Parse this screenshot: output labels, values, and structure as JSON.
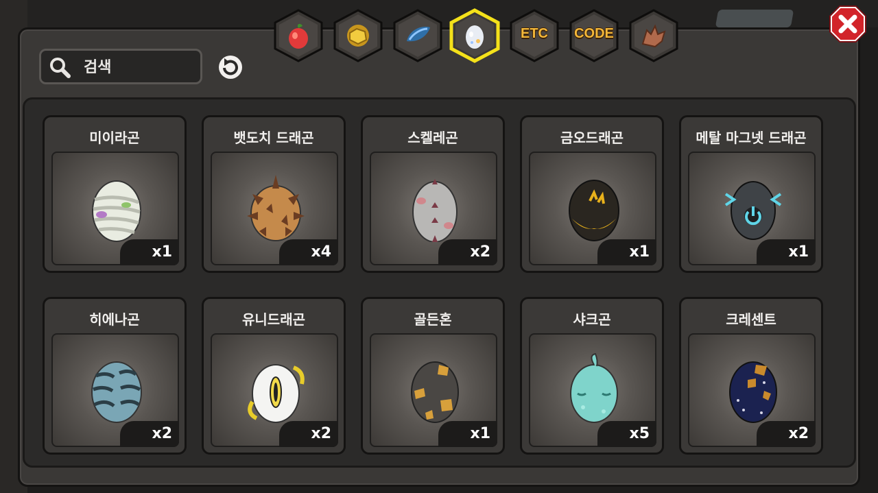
{
  "search": {
    "placeholder": "검색"
  },
  "tabs": [
    {
      "icon": "fruit-icon",
      "label": ""
    },
    {
      "icon": "gold-ore-icon",
      "label": ""
    },
    {
      "icon": "fish-icon",
      "label": ""
    },
    {
      "icon": "egg-icon",
      "label": "",
      "active": true
    },
    {
      "icon": "etc-icon",
      "label": "ETC"
    },
    {
      "icon": "code-icon",
      "label": "CODE"
    },
    {
      "icon": "dragon-head-icon",
      "label": ""
    }
  ],
  "items": [
    {
      "name": "미이라곤",
      "count": "x1",
      "egg": "mummy"
    },
    {
      "name": "뱃도치 드래곤",
      "count": "x4",
      "egg": "spiky"
    },
    {
      "name": "스켈레곤",
      "count": "x2",
      "egg": "skeleton"
    },
    {
      "name": "금오드래곤",
      "count": "x1",
      "egg": "golden-crow"
    },
    {
      "name": "메탈 마그넷 드래곤",
      "count": "x1",
      "egg": "metal-magnet"
    },
    {
      "name": "히에나곤",
      "count": "x2",
      "egg": "hyena"
    },
    {
      "name": "유니드래곤",
      "count": "x2",
      "egg": "uni"
    },
    {
      "name": "골든혼",
      "count": "x1",
      "egg": "golden-horn"
    },
    {
      "name": "샤크곤",
      "count": "x5",
      "egg": "shark"
    },
    {
      "name": "크레센트",
      "count": "x2",
      "egg": "crescent"
    }
  ],
  "colors": {
    "accent": "#f4d22a",
    "close": "#d2242a",
    "tab_gold": "#f4b83a"
  }
}
